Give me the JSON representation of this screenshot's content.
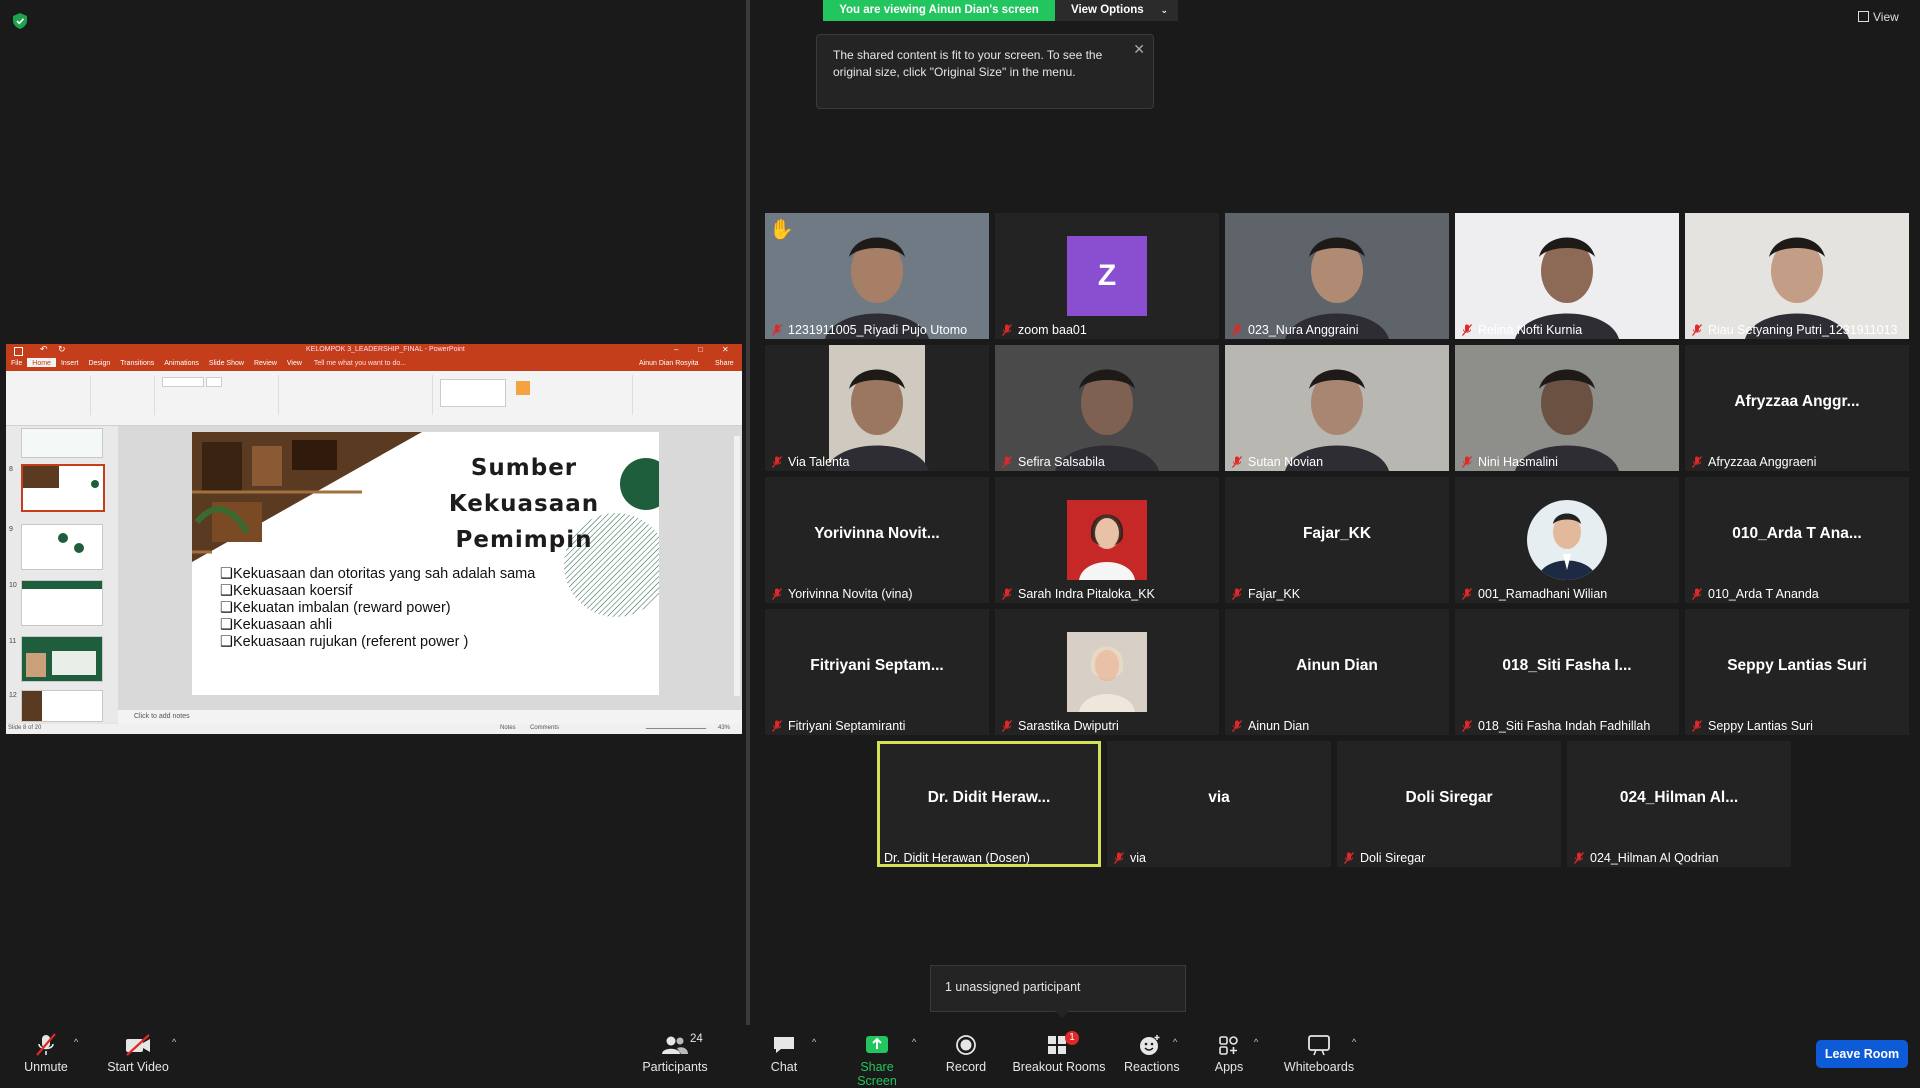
{
  "share": {
    "banner": "You are viewing Ainun Dian's screen",
    "view_options": "View Options",
    "tooltip": "The shared content is fit to your screen. To see the original size, click \"Original Size\" in the menu.",
    "view_label": "View"
  },
  "ppt": {
    "window_title": "KELOMPOK 3_LEADERSHIP_FINAL - PowerPoint",
    "user": "Ainun Dian Rosyita",
    "share_btn": "Share",
    "tabs": [
      "File",
      "Home",
      "Insert",
      "Design",
      "Transitions",
      "Animations",
      "Slide Show",
      "Review",
      "View"
    ],
    "tell_me": "Tell me what you want to do...",
    "slide_title_lines": [
      "Sumber",
      "Kekuasaan",
      "Pemimpin"
    ],
    "bullets": [
      "Kekuasaan dan otoritas yang sah adalah sama",
      "Kekuasaan koersif",
      "Kekuatan imbalan (reward power)",
      "Kekuasaan ahli",
      "Kekuasaan rujukan (referent power )"
    ],
    "thumb_numbers": [
      "8",
      "9",
      "10",
      "11",
      "12"
    ],
    "notes_placeholder": "Click to add notes",
    "status_slide": "Slide 8 of 20",
    "status_notes": "Notes",
    "status_comments": "Comments",
    "zoom": "43%"
  },
  "tiles": [
    {
      "label": "1231911005_Riyadi Pujo Utomo",
      "kind": "video",
      "hand": true
    },
    {
      "label": "zoom baa01",
      "kind": "letter",
      "letter": "Z"
    },
    {
      "label": "023_Nura Anggraini",
      "kind": "video"
    },
    {
      "label": "Relina Nofti Kurnia",
      "kind": "video"
    },
    {
      "label": "Riau Setyaning Putri_1231911013",
      "kind": "video"
    },
    {
      "label": "Via Talenta",
      "kind": "video"
    },
    {
      "label": "Sefira Salsabila",
      "kind": "video"
    },
    {
      "label": "Sutan Novian",
      "kind": "video"
    },
    {
      "label": "Nini Hasmalini",
      "kind": "video"
    },
    {
      "label": "Afryzzaa Anggraeni",
      "kind": "name",
      "big": "Afryzzaa  Anggr..."
    },
    {
      "label": "Yorivinna Novita (vina)",
      "kind": "name",
      "big": "Yorivinna  Novit..."
    },
    {
      "label": "Sarah Indra Pitaloka_KK",
      "kind": "photo"
    },
    {
      "label": "Fajar_KK",
      "kind": "name",
      "big": "Fajar_KK"
    },
    {
      "label": "001_Ramadhani Wilian",
      "kind": "photo-round"
    },
    {
      "label": "010_Arda T Ananda",
      "kind": "name",
      "big": "010_Arda T Ana..."
    },
    {
      "label": "Fitriyani Septamiranti",
      "kind": "name",
      "big": "Fitriyani  Septam..."
    },
    {
      "label": "Sarastika Dwiputri",
      "kind": "photo"
    },
    {
      "label": "Ainun Dian",
      "kind": "name",
      "big": "Ainun Dian"
    },
    {
      "label": "018_Siti Fasha Indah Fadhillah",
      "kind": "name",
      "big": "018_Siti Fasha I..."
    },
    {
      "label": "Seppy Lantias Suri",
      "kind": "name",
      "big": "Seppy Lantias Suri"
    },
    {
      "label": "Dr. Didit Herawan (Dosen)",
      "kind": "name",
      "big": "Dr.  Didit  Heraw...",
      "active": true,
      "muted": false
    },
    {
      "label": "via",
      "kind": "name",
      "big": "via"
    },
    {
      "label": "Doli Siregar",
      "kind": "name",
      "big": "Doli Siregar"
    },
    {
      "label": "024_Hilman Al Qodrian",
      "kind": "name",
      "big": "024_Hilman  Al..."
    }
  ],
  "popover": {
    "unassigned": "1 unassigned participant"
  },
  "toolbar": {
    "unmute": "Unmute",
    "start_video": "Start Video",
    "participants": "Participants",
    "participants_count": "24",
    "chat": "Chat",
    "share_screen": "Share Screen",
    "record": "Record",
    "breakout_rooms": "Breakout Rooms",
    "breakout_badge": "1",
    "reactions": "Reactions",
    "apps": "Apps",
    "whiteboards": "Whiteboards",
    "leave": "Leave Room"
  },
  "colors": {
    "accent_green": "#22c55e",
    "active_speaker": "#d4e157",
    "leave_blue": "#0e5bd8",
    "ppt_orange": "#c43e1c",
    "mute_red": "#e02828"
  }
}
